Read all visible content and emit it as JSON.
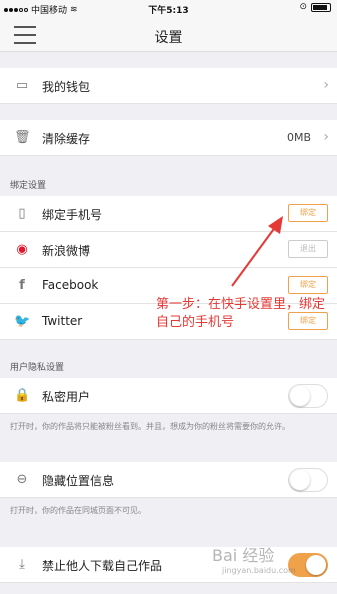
{
  "status_bar": {
    "carrier": "中国移动",
    "time": "下午5:13"
  },
  "nav": {
    "title": "设置",
    "menu_icon": "hamburger-icon"
  },
  "wallet": {
    "label": "我的钱包",
    "icon": "wallet-icon"
  },
  "cache": {
    "label": "清除缓存",
    "value": "0MB",
    "icon": "trash-icon"
  },
  "binding": {
    "header": "绑定设置",
    "items": [
      {
        "label": "绑定手机号",
        "button": "绑定",
        "icon": "phone-icon",
        "active": true
      },
      {
        "label": "新浪微博",
        "button": "退出",
        "icon": "weibo-icon",
        "active": false
      },
      {
        "label": "Facebook",
        "button": "绑定",
        "icon": "facebook-icon",
        "active": true
      },
      {
        "label": "Twitter",
        "button": "绑定",
        "icon": "twitter-icon",
        "active": true
      }
    ]
  },
  "privacy": {
    "header": "用户隐私设置",
    "private_user": {
      "label": "私密用户",
      "desc": "打开时，你的作品将只能被粉丝看到。并且，想成为你的粉丝将需要你的允许。",
      "on": false
    },
    "hide_location": {
      "label": "隐藏位置信息",
      "desc": "打开时，你的作品在同城页面不可见。",
      "on": false
    },
    "no_download": {
      "label": "禁止他人下载自己作品",
      "on": true
    }
  },
  "annotation": {
    "text": "第一步：在快手设置里，绑定自己的手机号"
  },
  "watermark": {
    "text": "Bai 经验",
    "sub": "jingyan.baidu.com"
  },
  "colors": {
    "accent": "#f0a24a",
    "annotation": "#e53935"
  }
}
